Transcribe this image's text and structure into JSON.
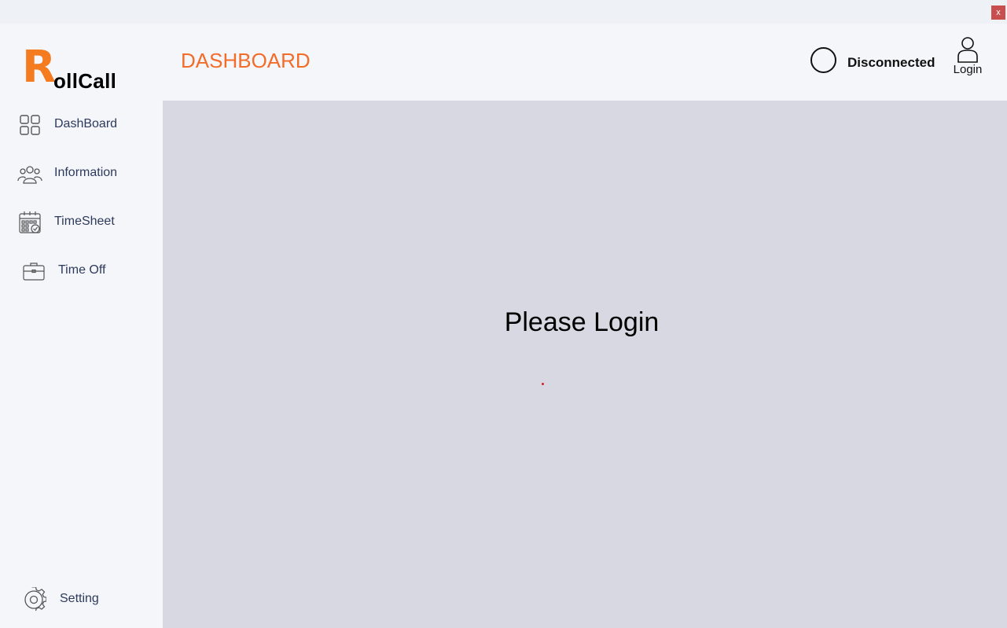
{
  "window": {
    "close_label": "x"
  },
  "logo": {
    "initial": "R",
    "rest": "ollCall"
  },
  "sidebar": {
    "items": [
      {
        "label": "DashBoard",
        "icon": "grid-icon"
      },
      {
        "label": "Information",
        "icon": "people-icon"
      },
      {
        "label": "TimeSheet",
        "icon": "calendar-icon"
      },
      {
        "label": "Time Off",
        "icon": "briefcase-icon"
      }
    ],
    "setting": {
      "label": "Setting",
      "icon": "gear-icon"
    }
  },
  "header": {
    "title": "DASHBOARD",
    "status": "Disconnected",
    "login_label": "Login"
  },
  "main": {
    "message": "Please Login"
  },
  "colors": {
    "accent": "#f47b20",
    "title": "#f26c2a",
    "nav_text": "#2e3a5c",
    "content_bg": "#d8d8e3",
    "close_bg": "#c94f4f"
  }
}
